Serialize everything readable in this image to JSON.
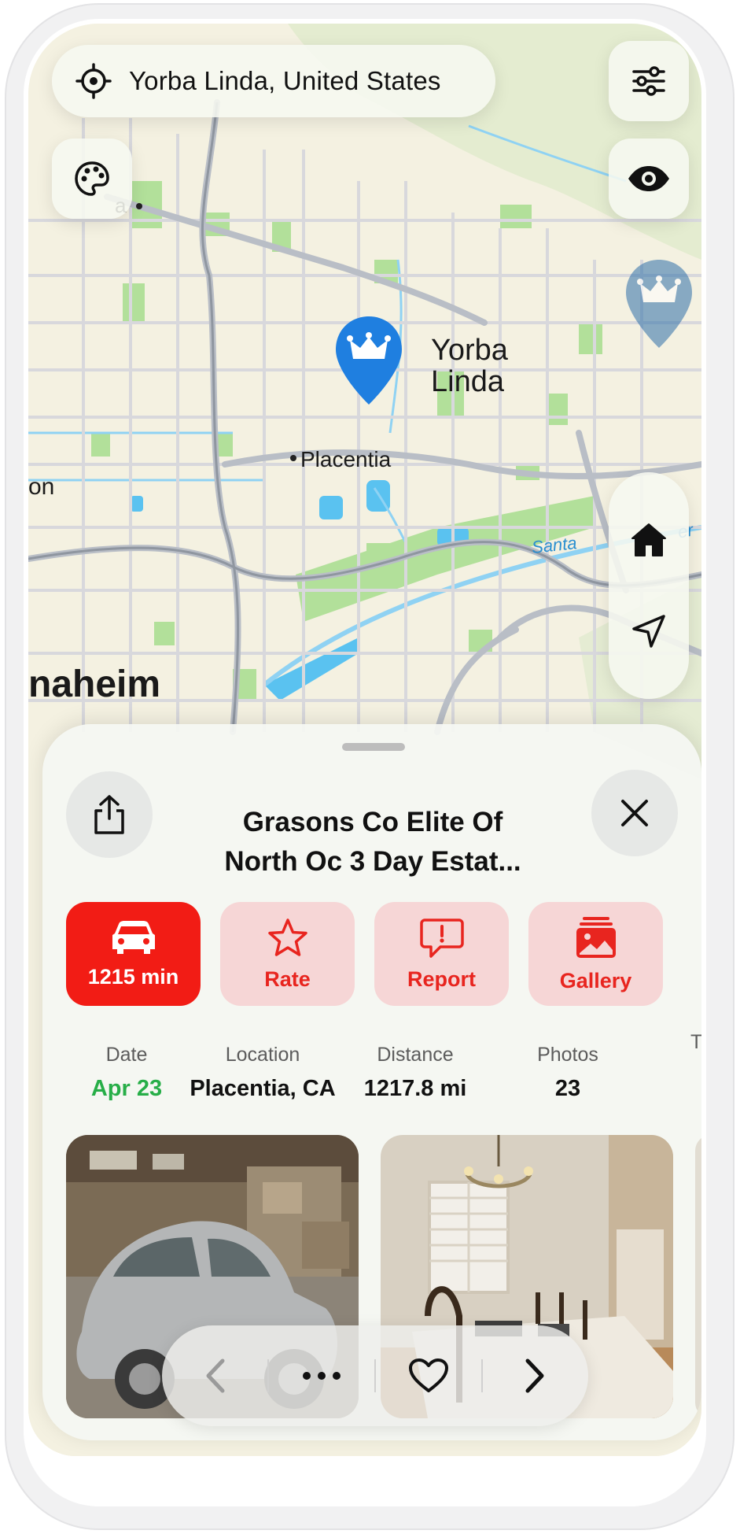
{
  "location_search": {
    "text": "Yorba Linda, United States"
  },
  "map": {
    "labels": {
      "city_main_line1": "Yorba",
      "city_main_line2": "Linda",
      "placentia": "Placentia",
      "anaheim": "naheim",
      "left_partial": "on",
      "top_left_partial": "a",
      "river": "Santa",
      "river_end": "er",
      "right_edge_partial": "T"
    },
    "pins": [
      "crown-pin-selected",
      "crown-pin"
    ]
  },
  "sheet": {
    "title_line1": "Grasons Co Elite Of",
    "title_line2": "North Oc 3 Day Estat...",
    "actions": [
      {
        "label": "1215 min",
        "icon": "car-icon"
      },
      {
        "label": "Rate",
        "icon": "star-icon"
      },
      {
        "label": "Report",
        "icon": "report-icon"
      },
      {
        "label": "Gallery",
        "icon": "gallery-icon"
      }
    ],
    "stats": [
      {
        "key": "Date",
        "value": "Apr 23"
      },
      {
        "key": "Location",
        "value": "Placentia, CA"
      },
      {
        "key": "Distance",
        "value": "1217.8 mi"
      },
      {
        "key": "Photos",
        "value": "23"
      }
    ]
  },
  "colors": {
    "accent_red": "#f21c15",
    "soft_red": "#f6d6d6",
    "date_green": "#27ae48",
    "pin_blue": "#1f7fe0",
    "map_water": "#5ac2f0",
    "map_green": "#a8dd88"
  }
}
